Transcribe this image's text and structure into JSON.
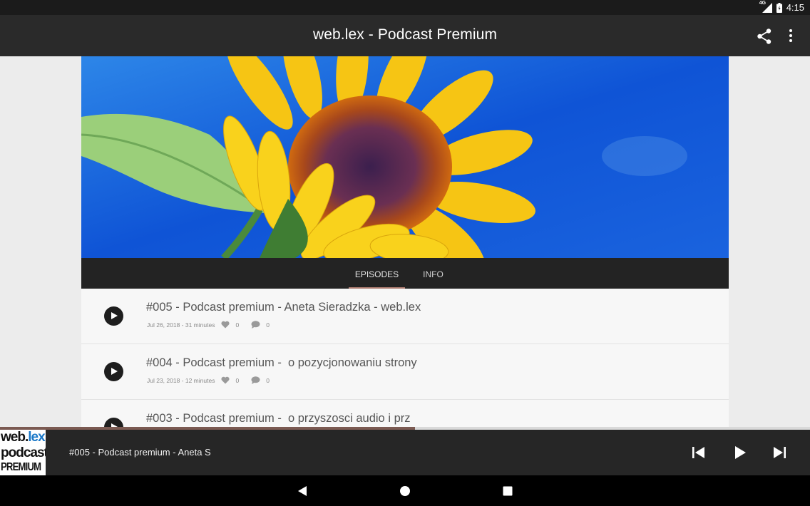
{
  "status_bar": {
    "network": "4G",
    "time": "4:15"
  },
  "app_bar": {
    "title": "web.lex - Podcast Premium",
    "actions": [
      "share-icon",
      "more-vert-icon"
    ]
  },
  "tabs": [
    {
      "label": "EPISODES",
      "active": true
    },
    {
      "label": "INFO",
      "active": false
    }
  ],
  "episodes": [
    {
      "title": "#005 - Podcast premium - Aneta Sieradzka - web.lex",
      "date_duration": "Jul 26, 2018 - 31 minutes",
      "likes": "0",
      "comments": "0"
    },
    {
      "title": "#004 - Podcast premium -  o pozycjonowaniu strony",
      "date_duration": "Jul 23, 2018 - 12 minutes",
      "likes": "0",
      "comments": "0"
    },
    {
      "title": "#003 - Podcast premium -  o przyszosci audio i prz",
      "date_duration": "",
      "likes": "",
      "comments": ""
    }
  ],
  "player": {
    "now_playing": "#005 - Podcast premium - Aneta S",
    "progress_fraction": 0.512,
    "cover_lines": [
      "web.",
      "lex",
      "podcast",
      "PREMIUM"
    ]
  },
  "colors": {
    "app_bar": "#2a2a2a",
    "tab_indicator": "#b07e72",
    "progress": "#7b5a52",
    "cover_accent": "#1a78c8"
  }
}
